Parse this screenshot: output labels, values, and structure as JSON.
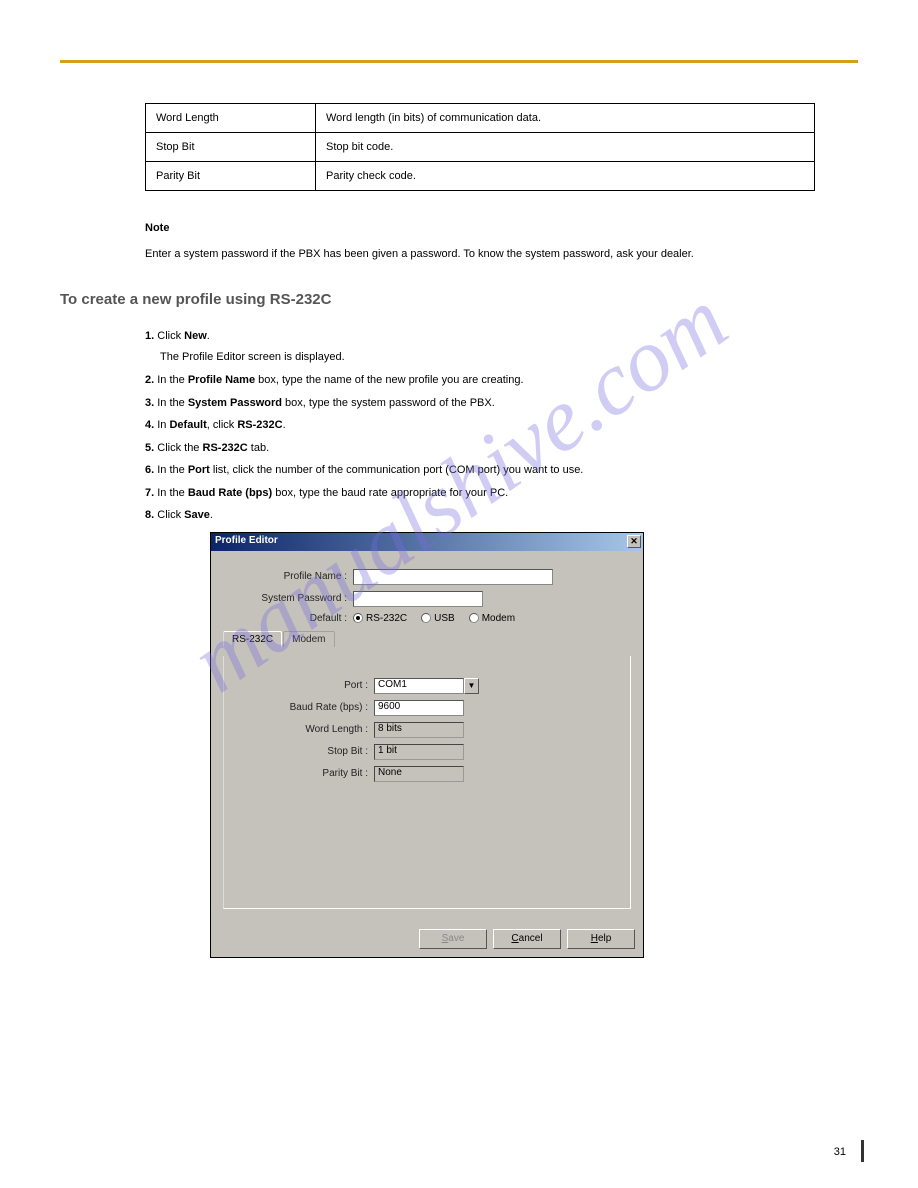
{
  "watermark": "manualshive.com",
  "table": {
    "rows": [
      {
        "label": "Word Length",
        "value": "Word length (in bits) of communication data."
      },
      {
        "label": "Stop Bit",
        "value": "Stop bit code."
      },
      {
        "label": "Parity Bit",
        "value": "Parity check code."
      }
    ]
  },
  "note": "Enter a system password if the PBX has been given a password. To know the system password, ask your dealer.",
  "heading": "To create a new profile using RS-232C",
  "steps": {
    "s1": {
      "num": "1.",
      "pre": "Click ",
      "b": "New",
      "post": "."
    },
    "s1a": "The Profile Editor screen is displayed.",
    "s2": {
      "num": "2.",
      "pre": "In the ",
      "b": "Profile Name",
      "post": " box, type the name of the new profile you are creating."
    },
    "s3": {
      "num": "3.",
      "pre": "In the ",
      "b": "System Password",
      "post": " box, type the system password of the PBX."
    },
    "s4": {
      "num": "4.",
      "pre": "In ",
      "b": "Default",
      "post": ", click ",
      "b2": "RS-232C",
      "post2": "."
    },
    "s5": {
      "num": "5.",
      "pre": "Click the ",
      "b": "RS-232C",
      "post": " tab."
    },
    "s6": {
      "num": "6.",
      "pre": "In the ",
      "b": "Port",
      "post": " list, click the number of the communication port (COM port) you want to use."
    },
    "s7": {
      "num": "7.",
      "pre": "In the ",
      "b": "Baud Rate (bps)",
      "post": " box, type the baud rate appropriate for your PC."
    },
    "s8": {
      "num": "8.",
      "pre": "Click ",
      "b": "Save",
      "post": "."
    }
  },
  "dialog": {
    "title": "Profile Editor",
    "profile_name_label": "Profile Name :",
    "profile_name_value": "",
    "system_password_label": "System Password :",
    "system_password_value": "",
    "default_label": "Default :",
    "radios": {
      "r1": "RS-232C",
      "r2": "USB",
      "r3": "Modem"
    },
    "tabs": {
      "t1": "RS-232C",
      "t2": "Modem"
    },
    "fields": {
      "port_label": "Port :",
      "port_value": "COM1",
      "baud_label": "Baud Rate (bps) :",
      "baud_value": "9600",
      "wordlen_label": "Word Length :",
      "wordlen_value": "8 bits",
      "stopbit_label": "Stop Bit :",
      "stopbit_value": "1 bit",
      "parity_label": "Parity Bit :",
      "parity_value": "None"
    },
    "buttons": {
      "save": "Save",
      "cancel": "Cancel",
      "help": "Help"
    }
  },
  "page_number": "31"
}
